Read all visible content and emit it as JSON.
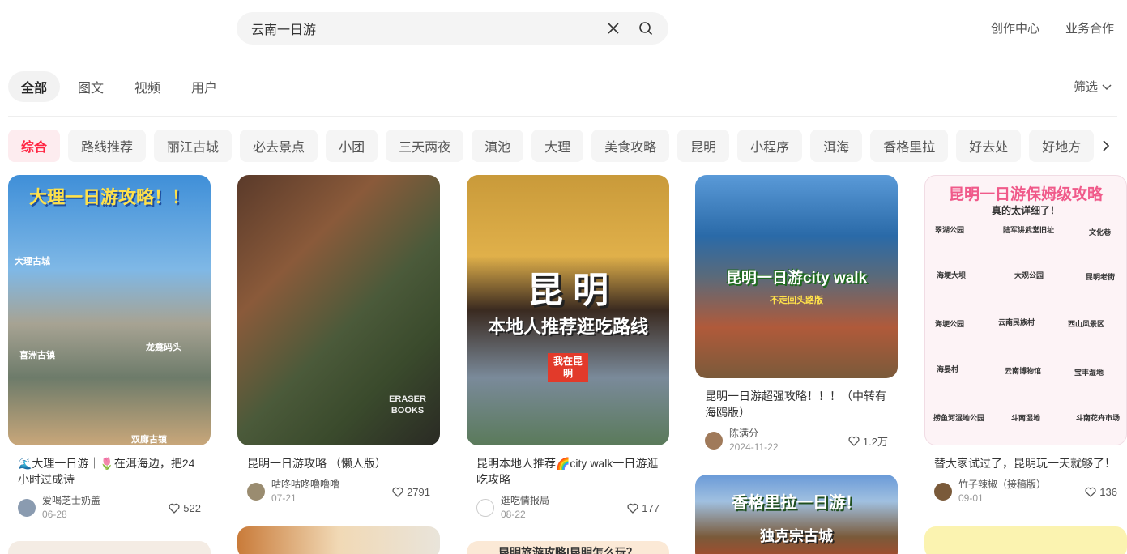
{
  "search": {
    "query": "云南一日游"
  },
  "toplinks": [
    "创作中心",
    "业务合作"
  ],
  "type_tabs": [
    "全部",
    "图文",
    "视频",
    "用户"
  ],
  "filter_label": "筛选",
  "chips": [
    "综合",
    "路线推荐",
    "丽江古城",
    "必去景点",
    "小团",
    "三天两夜",
    "滇池",
    "大理",
    "美食攻略",
    "昆明",
    "小程序",
    "洱海",
    "香格里拉",
    "好去处",
    "好地方"
  ],
  "cards": [
    {
      "cover_text": "大理一日游攻略！！",
      "cover_labels": [
        "大理古城",
        "喜洲古镇",
        "双廊古镇",
        "龙龛码头"
      ],
      "title": "🌊大理一日游｜🌷在洱海边，把24小时过成诗",
      "author": "爱喝芝士奶盖",
      "date": "06-28",
      "likes": "522"
    },
    {
      "cover_labels": [
        "ERASER BOOKS"
      ],
      "title": "昆明一日游攻略 （懒人版）",
      "author": "咕咚咕咚噜噜噜",
      "date": "07-21",
      "likes": "2791"
    },
    {
      "cover_text": "昆 明",
      "cover_subtext": "本地人推荐逛吃路线",
      "cover_labels": [
        "我在昆明"
      ],
      "title": "昆明本地人推荐🌈city walk一日游逛吃攻略",
      "author": "逛吃情报局",
      "date": "08-22",
      "likes": "177"
    },
    {
      "cover_text": "昆明一日游city walk",
      "cover_subtext": "不走回头路版",
      "title": "昆明一日游超强攻略！！！（中转有海鸥版）",
      "author": "陈满分",
      "date": "2024-11-22",
      "likes": "1.2万"
    },
    {
      "cover_text": "昆明一日游保姆级攻略",
      "cover_subtext": "真的太详细了！",
      "cover_labels": [
        "翠湖公园",
        "陆军讲武堂旧址",
        "文化巷",
        "海埂大坝",
        "大观公园",
        "昆明老街",
        "海埂公园",
        "云南民族村",
        "西山风景区",
        "海晏村",
        "云南博物馆",
        "宝丰湿地",
        "捞鱼河湿地公园",
        "斗南湿地",
        "斗南花卉市场"
      ],
      "title": "替大家试过了，昆明玩一天就够了！",
      "author": "竹子辣椒（接稿版）",
      "date": "09-01",
      "likes": "136"
    },
    {
      "cover_text": "香格里拉一日游！",
      "cover_subtext": "独克宗古城"
    },
    {
      "cover_text": "昆明旅游攻略|昆明怎么玩？"
    }
  ],
  "colors": {
    "accent": "#ff2442",
    "chip_bg": "#f5f5f5",
    "tab_active_bg": "#f2f2f2"
  }
}
